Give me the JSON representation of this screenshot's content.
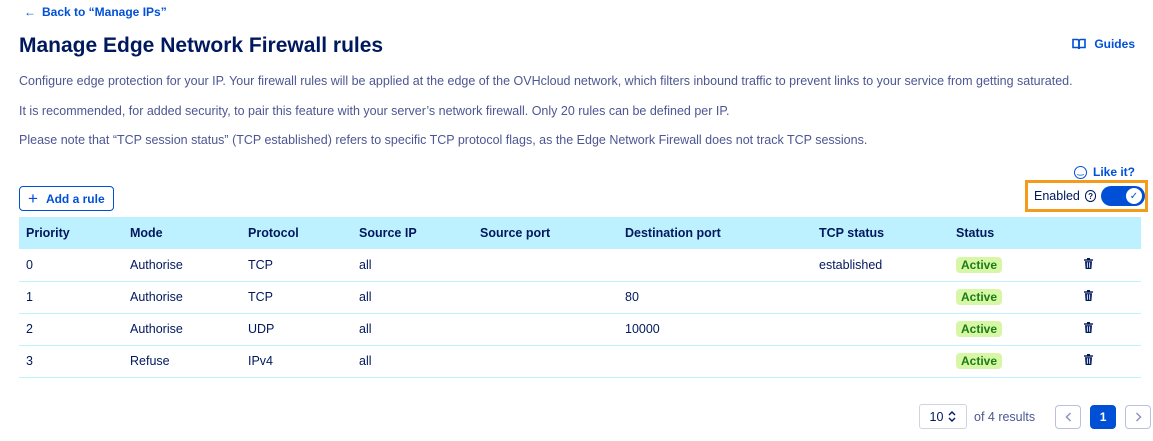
{
  "nav": {
    "back_label": "Back to “Manage IPs”"
  },
  "header": {
    "title": "Manage Edge Network Firewall rules",
    "guides_label": "Guides"
  },
  "descriptions": [
    "Configure edge protection for your IP. Your firewall rules will be applied at the edge of the OVHcloud network, which filters inbound traffic to prevent links to your service from getting saturated.",
    "It is recommended, for added security, to pair this feature with your server’s network firewall. Only 20 rules can be defined per IP.",
    "Please note that “TCP session status” (TCP established) refers to specific TCP protocol flags, as the Edge Network Firewall does not track TCP sessions."
  ],
  "feedback": {
    "label": "Like it?"
  },
  "toolbar": {
    "add_rule_label": "Add a rule"
  },
  "firewall": {
    "status_label": "Enabled",
    "enabled": true
  },
  "table": {
    "columns": [
      "Priority",
      "Mode",
      "Protocol",
      "Source IP",
      "Source port",
      "Destination port",
      "TCP status",
      "Status",
      ""
    ],
    "rows": [
      {
        "priority": "0",
        "mode": "Authorise",
        "protocol": "TCP",
        "source_ip": "all",
        "source_port": "",
        "destination_port": "",
        "tcp_status": "established",
        "status": "Active"
      },
      {
        "priority": "1",
        "mode": "Authorise",
        "protocol": "TCP",
        "source_ip": "all",
        "source_port": "",
        "destination_port": "80",
        "tcp_status": "",
        "status": "Active"
      },
      {
        "priority": "2",
        "mode": "Authorise",
        "protocol": "UDP",
        "source_ip": "all",
        "source_port": "",
        "destination_port": "10000",
        "tcp_status": "",
        "status": "Active"
      },
      {
        "priority": "3",
        "mode": "Refuse",
        "protocol": "IPv4",
        "source_ip": "all",
        "source_port": "",
        "destination_port": "",
        "tcp_status": "",
        "status": "Active"
      }
    ]
  },
  "pagination": {
    "page_size": "10",
    "results_text": "of 4 results",
    "current_page": "1"
  },
  "colors": {
    "accent": "#0050d7",
    "title": "#00185e",
    "header_bg": "#bef1ff",
    "highlight": "#f49b1c",
    "active_badge_bg": "#d8f7a6",
    "active_badge_text": "#1a7d14"
  },
  "icons": {
    "back": "arrow-left-icon",
    "guides": "book-icon",
    "feedback": "smile-icon",
    "add": "plus-icon",
    "help": "help-icon",
    "toggle": "check-icon",
    "delete": "trash-icon",
    "page_size": "chevron-updown-icon",
    "prev": "chevron-left-icon",
    "next": "chevron-right-icon"
  }
}
